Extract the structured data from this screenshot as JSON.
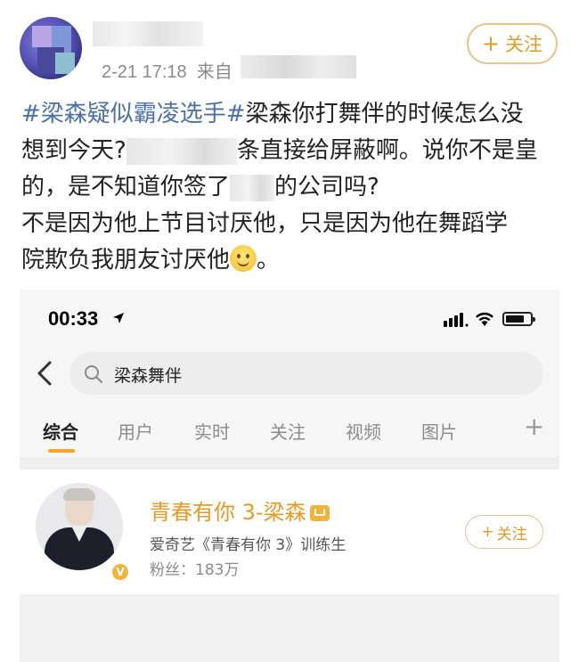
{
  "post": {
    "timestamp": "2-21 17:18",
    "source_label": "来自",
    "follow_label": "关注",
    "text": {
      "hashtag": "#梁森疑似霸凌选手#",
      "line1_rest": "梁森你打舞伴的时候怎么没",
      "line2_start": "想到今天?",
      "line2_end": "条直接给屏蔽啊。说你不是皇",
      "line3_start": "的，是不知道你签了",
      "line3_end": "的公司吗?",
      "line4": "不是因为他上节目讨厌他，只是因为他在舞蹈学",
      "line5_start": "院欺负我朋友讨厌他",
      "line5_end": "。"
    },
    "emoji_icon": "smile-emoji-icon"
  },
  "screenshot": {
    "status_bar": {
      "time": "00:33"
    },
    "search": {
      "query": "梁森舞伴"
    },
    "tabs": [
      {
        "label": "综合",
        "active": true
      },
      {
        "label": "用户",
        "active": false
      },
      {
        "label": "实时",
        "active": false
      },
      {
        "label": "关注",
        "active": false
      },
      {
        "label": "视频",
        "active": false
      },
      {
        "label": "图片",
        "active": false
      }
    ],
    "tab_add": "+",
    "user_card": {
      "name": "青春有你 3-梁森",
      "description": "爱奇艺《青春有你 3》训练生",
      "fans": "粉丝：183万",
      "follow_label": "关注",
      "verified_mark": "V"
    }
  },
  "colors": {
    "accent": "#e39a26",
    "hashtag": "#4b6fa8",
    "tab_indicator": "#f5a623"
  }
}
